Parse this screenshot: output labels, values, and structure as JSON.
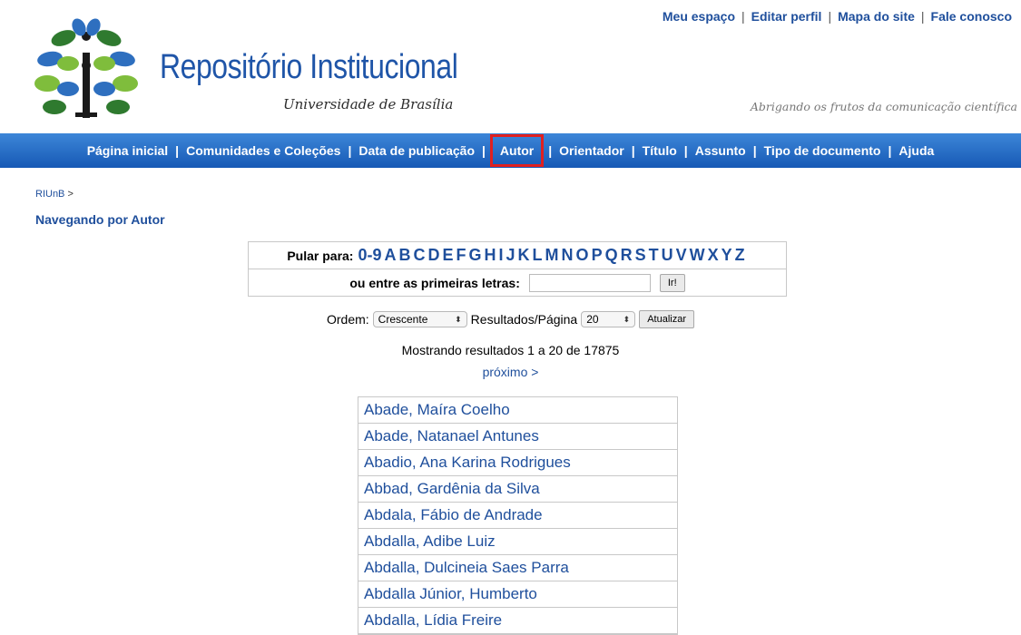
{
  "top_links": [
    "Meu espaço",
    "Editar perfil",
    "Mapa do site",
    "Fale conosco"
  ],
  "header": {
    "title": "Repositório Institucional",
    "subtitle": "Universidade de Brasília",
    "slogan": "Abrigando os frutos da comunicação científica"
  },
  "nav": {
    "items": [
      "Página inicial",
      "Comunidades e Coleções",
      "Data de publicação",
      "Autor",
      "Orientador",
      "Título",
      "Assunto",
      "Tipo de documento",
      "Ajuda"
    ],
    "active": "Autor",
    "highlight_color": "#e02020"
  },
  "breadcrumb": {
    "link": "RIUnB",
    "sep": ">"
  },
  "page_title": "Navegando por Autor",
  "jump": {
    "label": "Pular para:",
    "letters": [
      "0-9",
      "A",
      "B",
      "C",
      "D",
      "E",
      "F",
      "G",
      "H",
      "I",
      "J",
      "K",
      "L",
      "M",
      "N",
      "O",
      "P",
      "Q",
      "R",
      "S",
      "T",
      "U",
      "V",
      "W",
      "X",
      "Y",
      "Z"
    ],
    "first_letters_label": "ou entre as primeiras letras:",
    "first_letters_value": "",
    "go_button": "Ir!"
  },
  "controls": {
    "order_label": "Ordem:",
    "order_value": "Crescente",
    "results_label": "Resultados/Página",
    "results_value": "20",
    "update_button": "Atualizar"
  },
  "showing_text": "Mostrando resultados 1 a 20 de 17875",
  "next_link": "próximo >",
  "authors": [
    "Abade, Maíra Coelho",
    "Abade, Natanael Antunes",
    "Abadio, Ana Karina Rodrigues",
    "Abbad, Gardênia da Silva",
    "Abdala, Fábio de Andrade",
    "Abdalla, Adibe Luiz",
    "Abdalla, Dulcineia Saes Parra",
    "Abdalla Júnior, Humberto",
    "Abdalla, Lídia Freire"
  ],
  "colors": {
    "link": "#1f4f9c",
    "nav_bg": "#2a6fc8",
    "title": "#1f55a8"
  }
}
